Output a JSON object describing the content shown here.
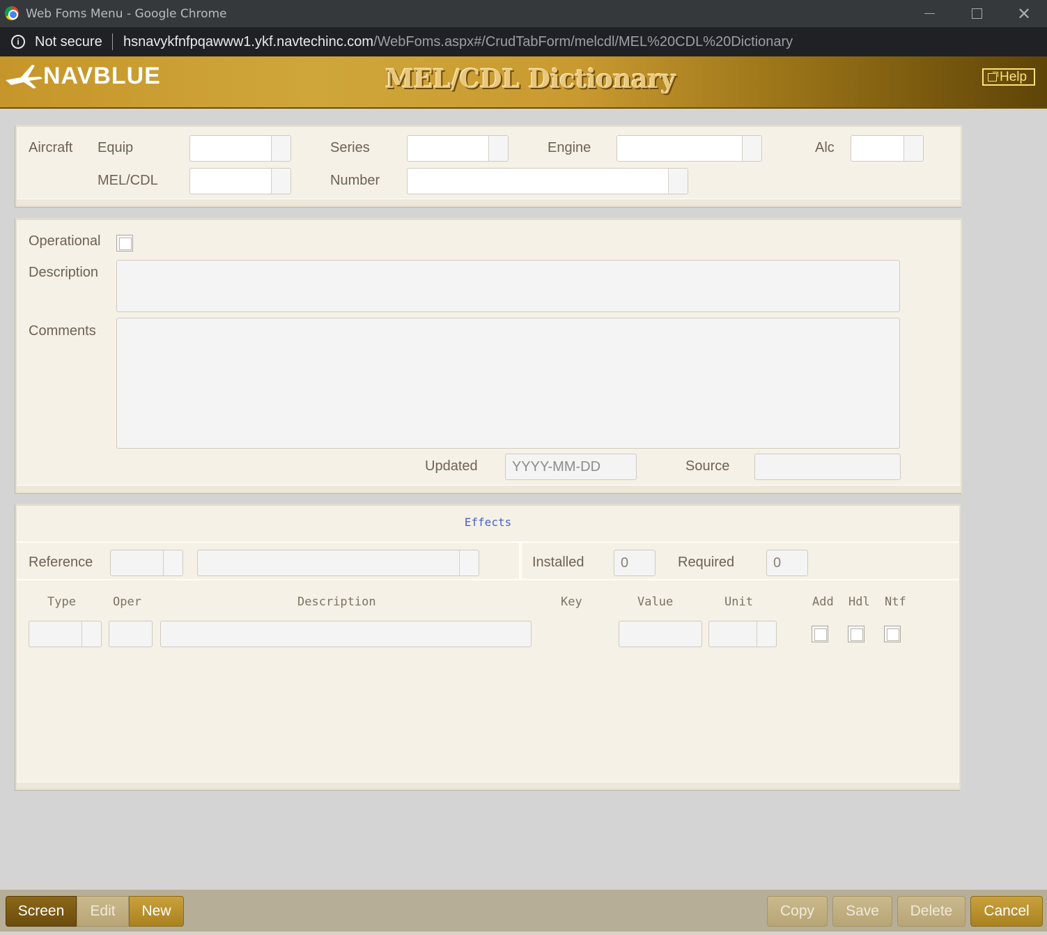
{
  "window": {
    "title": "Web Foms Menu - Google Chrome",
    "security": "Not secure",
    "url_host": "hsnavykfnfpqawww1.ykf.navtechinc.com",
    "url_path": "/WebFoms.aspx#/CrudTabForm/melcdl/MEL%20CDL%20Dictionary"
  },
  "header": {
    "brand": "NAVBLUE",
    "title": "MEL/CDL Dictionary",
    "help_label": "Help"
  },
  "aircraft_panel": {
    "section_label": "Aircraft",
    "equip_label": "Equip",
    "series_label": "Series",
    "engine_label": "Engine",
    "alc_label": "Alc",
    "melcdl_label": "MEL/CDL",
    "number_label": "Number"
  },
  "detail_panel": {
    "operational_label": "Operational",
    "description_label": "Description",
    "comments_label": "Comments",
    "updated_label": "Updated",
    "updated_placeholder": "YYYY-MM-DD",
    "source_label": "Source"
  },
  "effects_panel": {
    "title": "Effects",
    "reference_label": "Reference",
    "installed_label": "Installed",
    "installed_value": "0",
    "required_label": "Required",
    "required_value": "0",
    "columns": {
      "type": "Type",
      "oper": "Oper",
      "description": "Description",
      "key": "Key",
      "value": "Value",
      "unit": "Unit",
      "add": "Add",
      "hdl": "Hdl",
      "ntf": "Ntf"
    }
  },
  "footer": {
    "screen": "Screen",
    "edit": "Edit",
    "new": "New",
    "copy": "Copy",
    "save": "Save",
    "delete": "Delete",
    "cancel": "Cancel"
  }
}
